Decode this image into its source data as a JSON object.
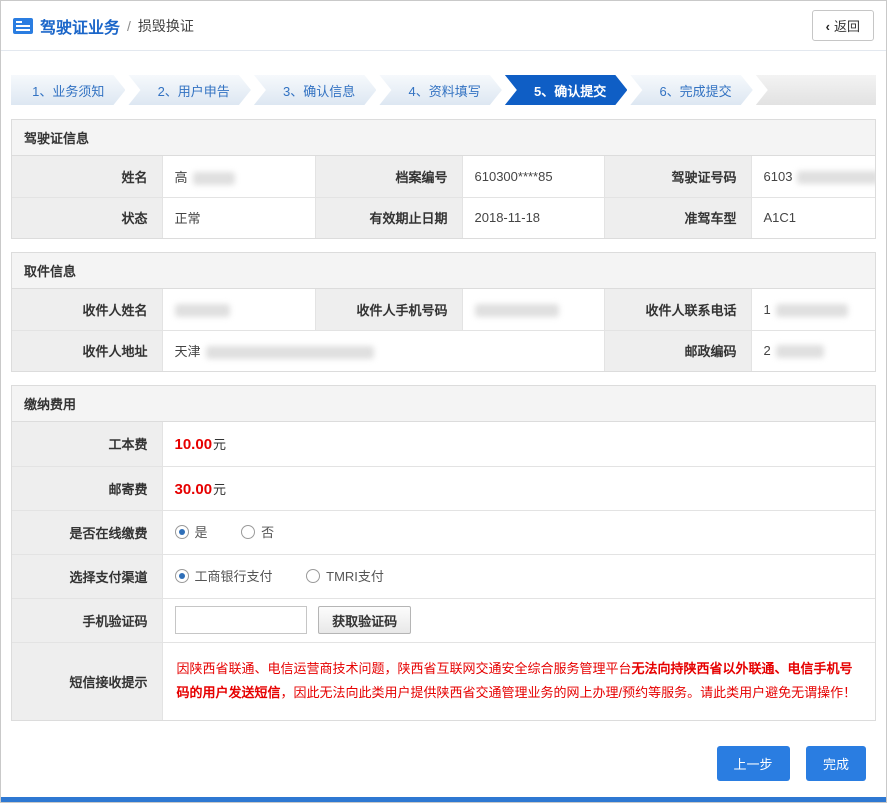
{
  "header": {
    "title": "驾驶证业务",
    "separator": "/",
    "subtitle": "损毁换证",
    "back_icon": "‹",
    "back_label": "返回"
  },
  "steps": [
    {
      "label": "1、业务须知"
    },
    {
      "label": "2、用户申告"
    },
    {
      "label": "3、确认信息"
    },
    {
      "label": "4、资料填写"
    },
    {
      "label": "5、确认提交"
    },
    {
      "label": "6、完成提交"
    }
  ],
  "license_info": {
    "title": "驾驶证信息",
    "name_label": "姓名",
    "name_value": "高",
    "file_number_label": "档案编号",
    "file_number_value": "610300****85",
    "license_number_label": "驾驶证号码",
    "license_number_value": "6103",
    "status_label": "状态",
    "status_value": "正常",
    "expiry_label": "有效期止日期",
    "expiry_value": "2018-11-18",
    "vehicle_class_label": "准驾车型",
    "vehicle_class_value": "A1C1"
  },
  "pickup_info": {
    "title": "取件信息",
    "recipient_name_label": "收件人姓名",
    "recipient_mobile_label": "收件人手机号码",
    "recipient_phone_label": "收件人联系电话",
    "recipient_phone_value": "1",
    "address_label": "收件人地址",
    "address_value": "天津",
    "postcode_label": "邮政编码",
    "postcode_value": "2"
  },
  "fees": {
    "title": "缴纳费用",
    "production_fee_label": "工本费",
    "production_fee_amount": "10.00",
    "postage_fee_label": "邮寄费",
    "postage_fee_amount": "30.00",
    "currency_unit": "元",
    "online_payment_label": "是否在线缴费",
    "online_yes_label": "是",
    "online_no_label": "否",
    "channel_label": "选择支付渠道",
    "channel_icbc_label": "工商银行支付",
    "channel_tmri_label": "TMRI支付",
    "sms_code_label": "手机验证码",
    "get_code_button": "获取验证码",
    "notice_label": "短信接收提示",
    "notice_part1": "因陕西省联通、电信运营商技术问题，陕西省互联网交通安全综合服务管理平台",
    "notice_bold": "无法向持陕西省以外联通、电信手机号码的用户发送短信",
    "notice_part2": "，因此无法向此类用户提供陕西省交通管理业务的网上办理/预约等服务。请此类用户避免无谓操作！"
  },
  "footer": {
    "prev_button": "上一步",
    "finish_button": "完成"
  }
}
